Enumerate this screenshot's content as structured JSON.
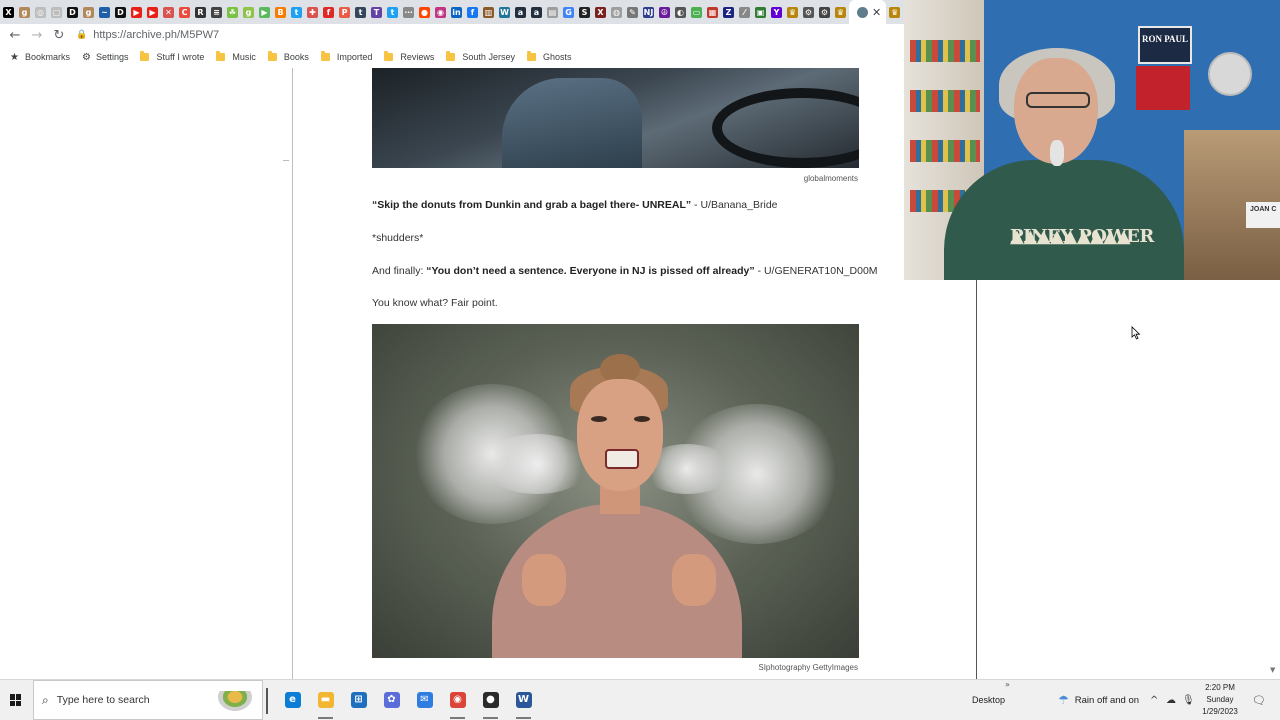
{
  "browser": {
    "tab_favicons": [
      {
        "icon": "x-icon",
        "glyph": "X",
        "color": "#000000"
      },
      {
        "icon": "goodreads-icon",
        "glyph": "g",
        "color": "#b08a5a"
      },
      {
        "icon": "circle-icon",
        "glyph": "◎",
        "color": "#bdbdbd"
      },
      {
        "icon": "page-icon",
        "glyph": "▢",
        "color": "#bdbdbd"
      },
      {
        "icon": "imdb-icon",
        "glyph": "D",
        "color": "#111111"
      },
      {
        "icon": "goodreads-icon",
        "glyph": "g",
        "color": "#b08a5a"
      },
      {
        "icon": "wave-icon",
        "glyph": "~",
        "color": "#1f5fa8"
      },
      {
        "icon": "imdb-icon",
        "glyph": "D",
        "color": "#111111"
      },
      {
        "icon": "youtube-icon",
        "glyph": "▶",
        "color": "#e62117"
      },
      {
        "icon": "youtube-icon",
        "glyph": "▶",
        "color": "#e62117"
      },
      {
        "icon": "crossed-icon",
        "glyph": "✕",
        "color": "#d9534f"
      },
      {
        "icon": "refresh-icon",
        "glyph": "C",
        "color": "#e74c3c"
      },
      {
        "icon": "rotten-icon",
        "glyph": "R",
        "color": "#333333"
      },
      {
        "icon": "list-icon",
        "glyph": "≡",
        "color": "#444444"
      },
      {
        "icon": "leaf-icon",
        "glyph": "☘",
        "color": "#7cc242"
      },
      {
        "icon": "goodreads-icon",
        "glyph": "g",
        "color": "#8fc34b"
      },
      {
        "icon": "play-icon",
        "glyph": "▶",
        "color": "#5cb85c"
      },
      {
        "icon": "blogger-icon",
        "glyph": "B",
        "color": "#f57d00"
      },
      {
        "icon": "twitter-icon",
        "glyph": "t",
        "color": "#1da1f2"
      },
      {
        "icon": "gift-icon",
        "glyph": "✚",
        "color": "#d9534f"
      },
      {
        "icon": "flipboard-icon",
        "glyph": "f",
        "color": "#e12828"
      },
      {
        "icon": "patreon-icon",
        "glyph": "P",
        "color": "#e85b46"
      },
      {
        "icon": "tumblr-icon",
        "glyph": "t",
        "color": "#35465c"
      },
      {
        "icon": "tv-icon",
        "glyph": "T",
        "color": "#6441a5"
      },
      {
        "icon": "twitter-icon",
        "glyph": "t",
        "color": "#1da1f2"
      },
      {
        "icon": "dots-icon",
        "glyph": "⋯",
        "color": "#888888"
      },
      {
        "icon": "reddit-icon",
        "glyph": "●",
        "color": "#ff4500"
      },
      {
        "icon": "instagram-icon",
        "glyph": "◉",
        "color": "#c13584"
      },
      {
        "icon": "linkedin-icon",
        "glyph": "in",
        "color": "#0a66c2"
      },
      {
        "icon": "facebook-icon",
        "glyph": "f",
        "color": "#1877f2"
      },
      {
        "icon": "book-icon",
        "glyph": "▥",
        "color": "#8b5a2b"
      },
      {
        "icon": "wordpress-icon",
        "glyph": "W",
        "color": "#21759b"
      },
      {
        "icon": "amazon-icon",
        "glyph": "a",
        "color": "#232f3e"
      },
      {
        "icon": "amazon-icon",
        "glyph": "a",
        "color": "#232f3e"
      },
      {
        "icon": "chart-icon",
        "glyph": "▤",
        "color": "#9e9e9e"
      },
      {
        "icon": "google-icon",
        "glyph": "G",
        "color": "#4285f4"
      },
      {
        "icon": "s-icon",
        "glyph": "S",
        "color": "#222222"
      },
      {
        "icon": "red-x-icon",
        "glyph": "X",
        "color": "#7b1f1f"
      },
      {
        "icon": "gray-circle-icon",
        "glyph": "◍",
        "color": "#9e9e9e"
      },
      {
        "icon": "pen-icon",
        "glyph": "✎",
        "color": "#777777"
      },
      {
        "icon": "nj-icon",
        "glyph": "NJ",
        "color": "#2c3e8f"
      },
      {
        "icon": "peace-icon",
        "glyph": "☮",
        "color": "#6a1b9a"
      },
      {
        "icon": "globe-icon",
        "glyph": "◐",
        "color": "#555555"
      },
      {
        "icon": "minus-icon",
        "glyph": "▭",
        "color": "#4caf50"
      },
      {
        "icon": "grid-icon",
        "glyph": "▦",
        "color": "#c0392b"
      },
      {
        "icon": "z-icon",
        "glyph": "Z",
        "color": "#1a237e"
      },
      {
        "icon": "slash-icon",
        "glyph": "⁄",
        "color": "#888888"
      },
      {
        "icon": "gallery-icon",
        "glyph": "▣",
        "color": "#2e7d32"
      },
      {
        "icon": "yahoo-icon",
        "glyph": "Y",
        "color": "#6001d2"
      },
      {
        "icon": "crown-icon",
        "glyph": "♛",
        "color": "#b8860b"
      },
      {
        "icon": "settings-icon",
        "glyph": "⚙",
        "color": "#555555"
      },
      {
        "icon": "gear-icon",
        "glyph": "⚙",
        "color": "#444444"
      },
      {
        "icon": "crown-icon",
        "glyph": "♛",
        "color": "#b8860b"
      },
      {
        "icon": "crown-icon",
        "glyph": "♛",
        "color": "#b8860b"
      },
      {
        "icon": "crown-icon",
        "glyph": "♛",
        "color": "#b8860b"
      }
    ],
    "active_tab_icon": "archive-icon",
    "url": "https://archive.ph/M5PW7",
    "bookmarks": {
      "bookmarks_label": "Bookmarks",
      "settings_label": "Settings",
      "folders": [
        "Stuff I wrote",
        "Music",
        "Books",
        "Imported",
        "Reviews",
        "South Jersey",
        "Ghosts"
      ]
    }
  },
  "article": {
    "credit_1": "globalmoments",
    "p1_quote": "“Skip the donuts from Dunkin and grab a bagel there- UNREAL”",
    "p1_author": " - U/Banana_Bride",
    "p2": "*shudders*",
    "p3_prefix": "And finally: ",
    "p3_quote": "“You don’t need a sentence. Everyone in NJ is pissed off already”",
    "p3_author": " - U/GENERAT10N_D00M",
    "p4": "You know what? Fair point.",
    "credit_2": "SIphotography GettyImages"
  },
  "webcam": {
    "shirt_text": "PINEY POWER",
    "sign_text": "RON PAUL",
    "tag_text": "JOAN C"
  },
  "taskbar": {
    "search_placeholder": "Type here to search",
    "apps": [
      {
        "icon": "edge-icon",
        "glyph": "e",
        "color": "#0c7cd5",
        "running": false
      },
      {
        "icon": "file-explorer-icon",
        "glyph": "▬",
        "color": "#f2b632",
        "running": true
      },
      {
        "icon": "store-icon",
        "glyph": "⊞",
        "color": "#1f6fbf",
        "running": false
      },
      {
        "icon": "photos-icon",
        "glyph": "✿",
        "color": "#5a6dd8",
        "running": false
      },
      {
        "icon": "mail-icon",
        "glyph": "✉",
        "color": "#2f7de1",
        "running": false
      },
      {
        "icon": "chrome-icon",
        "glyph": "◉",
        "color": "#db4437",
        "running": true
      },
      {
        "icon": "obs-icon",
        "glyph": "●",
        "color": "#2b2b2b",
        "running": true
      },
      {
        "icon": "word-icon",
        "glyph": "W",
        "color": "#2b579a",
        "running": true
      }
    ],
    "desktop_label": "Desktop",
    "chevron": "»",
    "weather": "Rain off and on",
    "clock_time": "2:20 PM",
    "clock_day": "Sunday",
    "clock_date": "1/29/2023"
  }
}
